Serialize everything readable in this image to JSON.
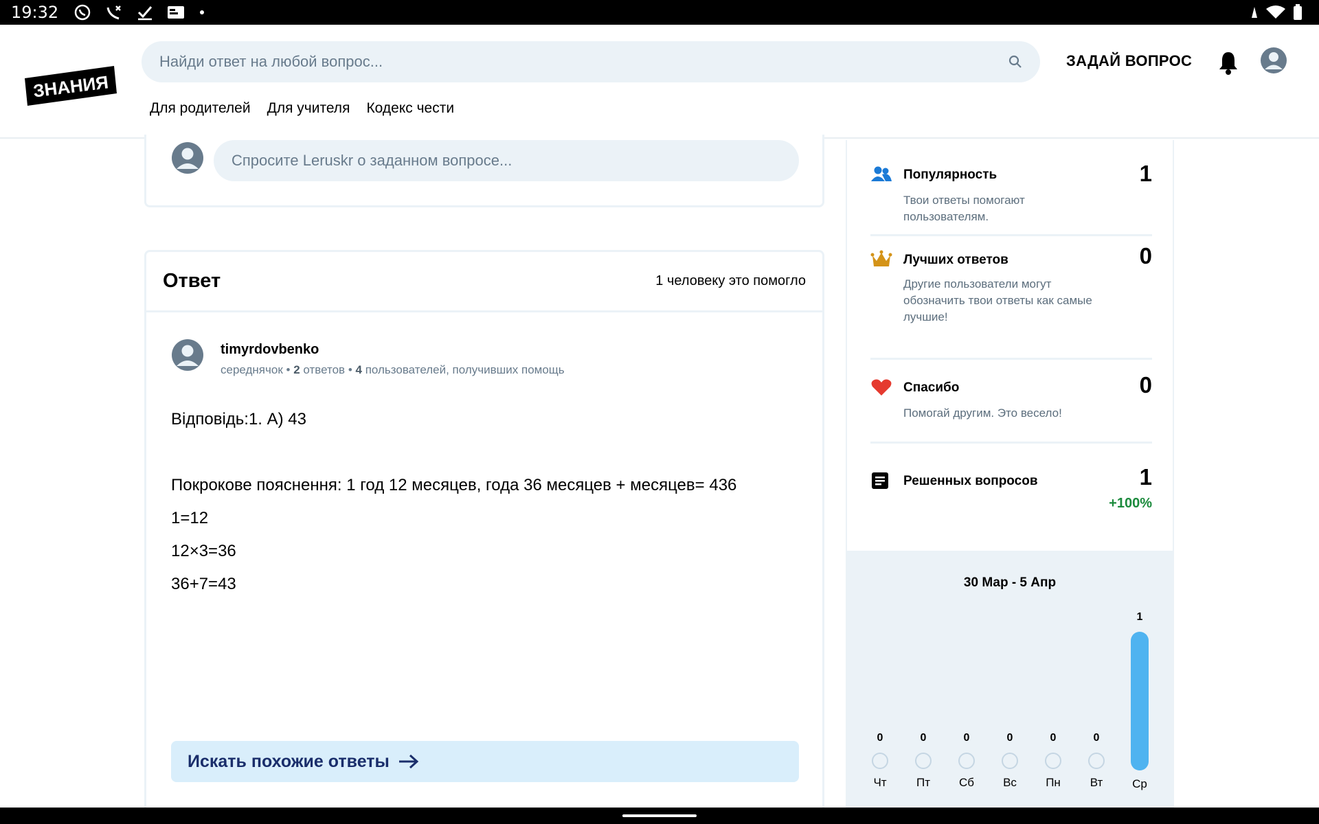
{
  "status_bar": {
    "time": "19:32",
    "icons": [
      "viber-icon",
      "missed-call-icon",
      "check-icon",
      "card-icon",
      "dot-icon"
    ],
    "right_icons": [
      "vibrate-icon",
      "wifi-icon",
      "battery-icon"
    ]
  },
  "header": {
    "logo_text": "ЗНАНИЯ",
    "search_placeholder": "Найди ответ на любой вопрос...",
    "ask_button": "ЗАДАЙ ВОПРОС",
    "nav": [
      "Для родителей",
      "Для учителя",
      "Кодекс чести"
    ]
  },
  "ask_card": {
    "placeholder": "Спросите Leruskr о заданном вопросе..."
  },
  "answer": {
    "title": "Ответ",
    "helped": "1 человеку это помогло",
    "author": {
      "name": "timyrdovbenko",
      "rank": "середнячок",
      "answers_count": "2",
      "answers_label": "ответов",
      "helped_count": "4",
      "helped_label": "пользователей, получивших помощь"
    },
    "lines": [
      "Відповідь:1. А) 43",
      "",
      "Покрокове пояснення: 1 год 12 месяцев, года 36 месяцев + месяцев= 436",
      "1=12",
      "12×3=36",
      "36+7=43"
    ],
    "similar_button": "Искать похожие ответы"
  },
  "stats": [
    {
      "icon": "users-icon",
      "title": "Популярность",
      "value": "1",
      "desc": "Твои ответы помогают пользователям."
    },
    {
      "icon": "crown-icon",
      "title": "Лучших ответов",
      "value": "0",
      "desc": "Другие пользователи могут обозначить твои ответы как самые лучшие!"
    },
    {
      "icon": "heart-icon",
      "title": "Спасибо",
      "value": "0",
      "desc": "Помогай другим. Это весело!"
    },
    {
      "icon": "document-icon",
      "title": "Решенных вопросов",
      "value": "1",
      "extra": "+100%"
    }
  ],
  "weekly": {
    "range": "30 Мар - 5 Апр",
    "days": [
      {
        "label": "Чт",
        "count": "0"
      },
      {
        "label": "Пт",
        "count": "0"
      },
      {
        "label": "Сб",
        "count": "0"
      },
      {
        "label": "Вс",
        "count": "0"
      },
      {
        "label": "Пн",
        "count": "0"
      },
      {
        "label": "Вт",
        "count": "0"
      },
      {
        "label": "Ср",
        "count": "1"
      }
    ],
    "accent": "#4fb3f0"
  }
}
